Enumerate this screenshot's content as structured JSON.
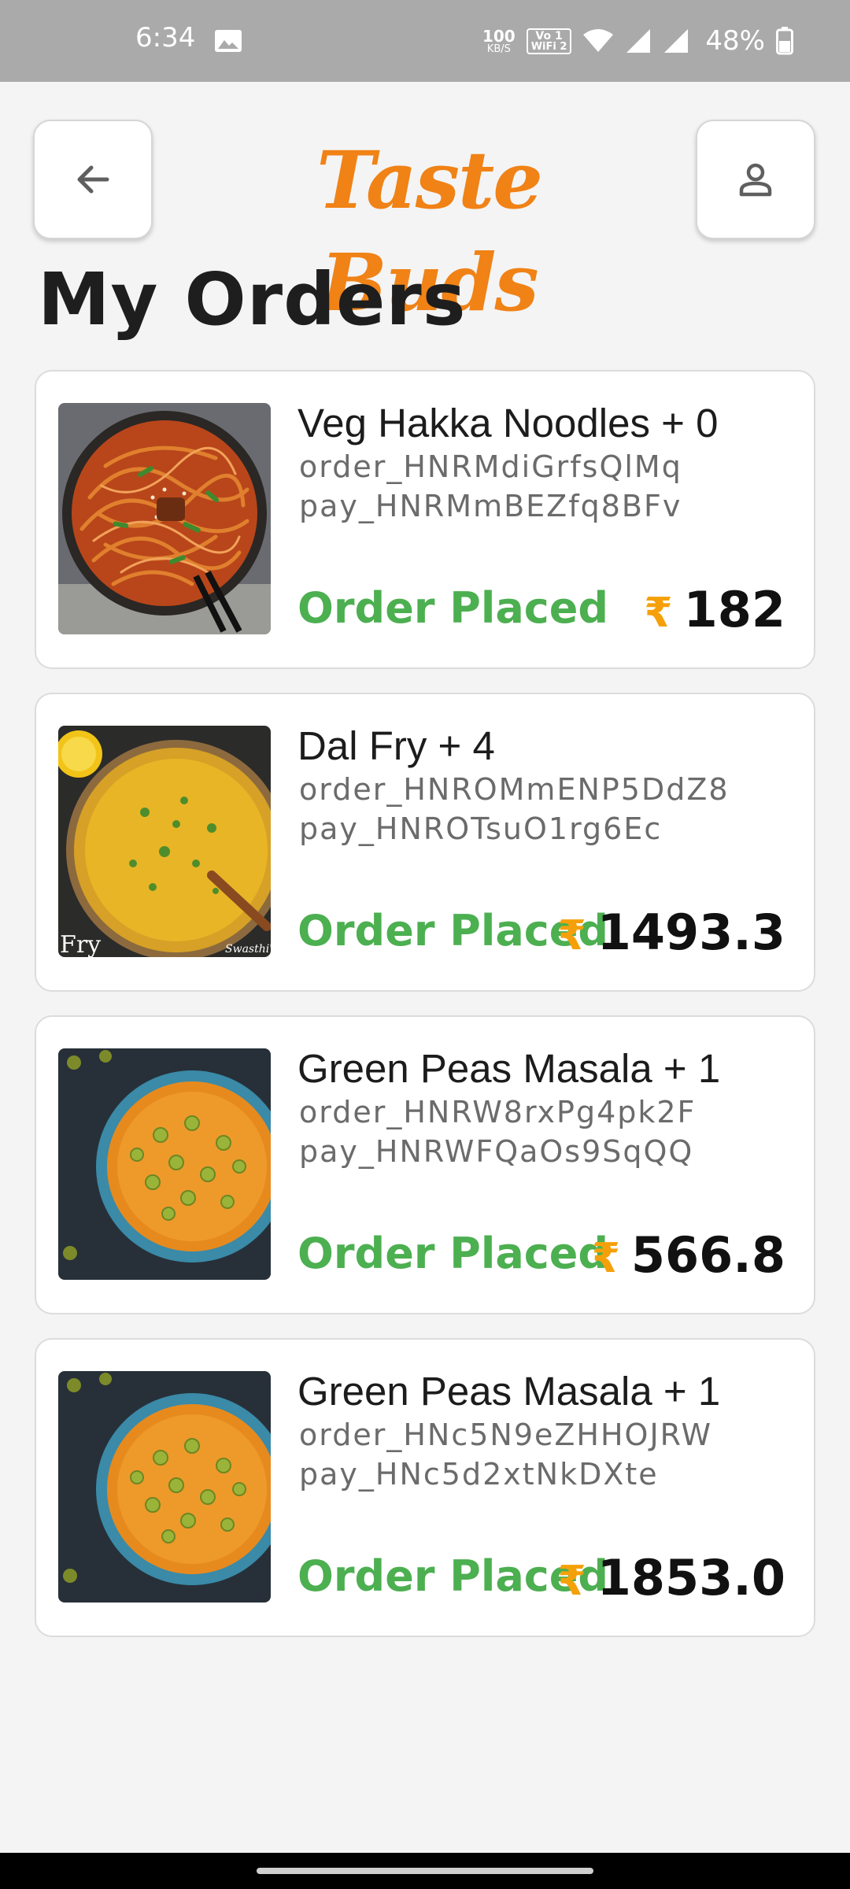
{
  "status_bar": {
    "time": "6:34",
    "net_speed_value": "100",
    "net_speed_unit": "KB/S",
    "vowifi_top": "Vo 1",
    "vowifi_bottom": "WiFi 2",
    "battery": "48%",
    "icons": [
      "photo-icon",
      "wifi-icon",
      "signal-icon",
      "signal-icon",
      "battery-icon"
    ]
  },
  "header": {
    "brand": "Taste Buds",
    "back_icon": "arrow-left-icon",
    "profile_icon": "person-icon",
    "brand_color": "#f08216"
  },
  "page": {
    "title": "My Orders"
  },
  "orders": [
    {
      "title": "Veg Hakka Noodles + 0",
      "order_id": "order_HNRMdiGrfsQlMq",
      "pay_id": "pay_HNRMmBEZfq8BFv",
      "status": "Order Placed",
      "currency": "₹",
      "amount": "182",
      "image": "noodles"
    },
    {
      "title": "Dal Fry + 4",
      "order_id": "order_HNROMmENP5DdZ8",
      "pay_id": "pay_HNROTsuO1rg6Ec",
      "status": "Order Placed",
      "currency": "₹",
      "amount": "1493.3",
      "image": "dal",
      "image_caption_left": "Fry",
      "image_caption_right": "Swasthi's"
    },
    {
      "title": "Green Peas Masala + 1",
      "order_id": "order_HNRW8rxPg4pk2F",
      "pay_id": "pay_HNRWFQaOs9SqQQ",
      "status": "Order Placed",
      "currency": "₹",
      "amount": "566.8",
      "image": "peas"
    },
    {
      "title": "Green Peas Masala + 1",
      "order_id": "order_HNc5N9eZHHOJRW",
      "pay_id": "pay_HNc5d2xtNkDXte",
      "status": "Order Placed",
      "currency": "₹",
      "amount": "1853.0",
      "image": "peas"
    }
  ],
  "colors": {
    "status_green": "#4caf50",
    "rupee_orange": "#f5a00a",
    "status_bar_bg": "#aaaaaa"
  }
}
